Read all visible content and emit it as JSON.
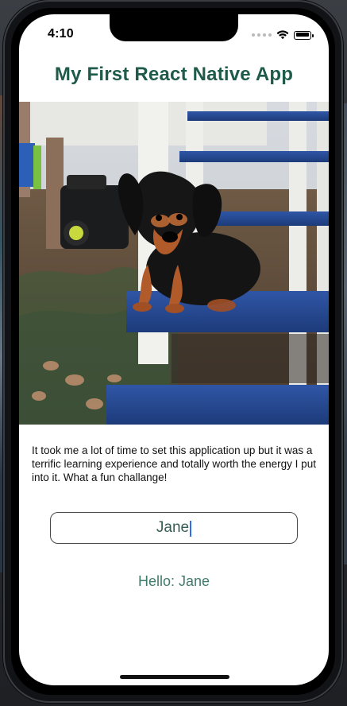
{
  "status_bar": {
    "time": "4:10",
    "icons": [
      "signal-dots-icon",
      "wifi-icon",
      "battery-icon"
    ]
  },
  "app": {
    "title": "My First React Native App",
    "hero_image_alt": "photo",
    "description": "It took me a lot of time to set this application up but it was a terrific learning experience and totally worth the energy I put into it. What a fun challange!",
    "input_value": "Jane",
    "greeting": "Hello: Jane"
  },
  "colors": {
    "title": "#1f5a4a",
    "greeting": "#3e7a6a",
    "input_text": "#375e55",
    "caret": "#2d6cf6"
  }
}
